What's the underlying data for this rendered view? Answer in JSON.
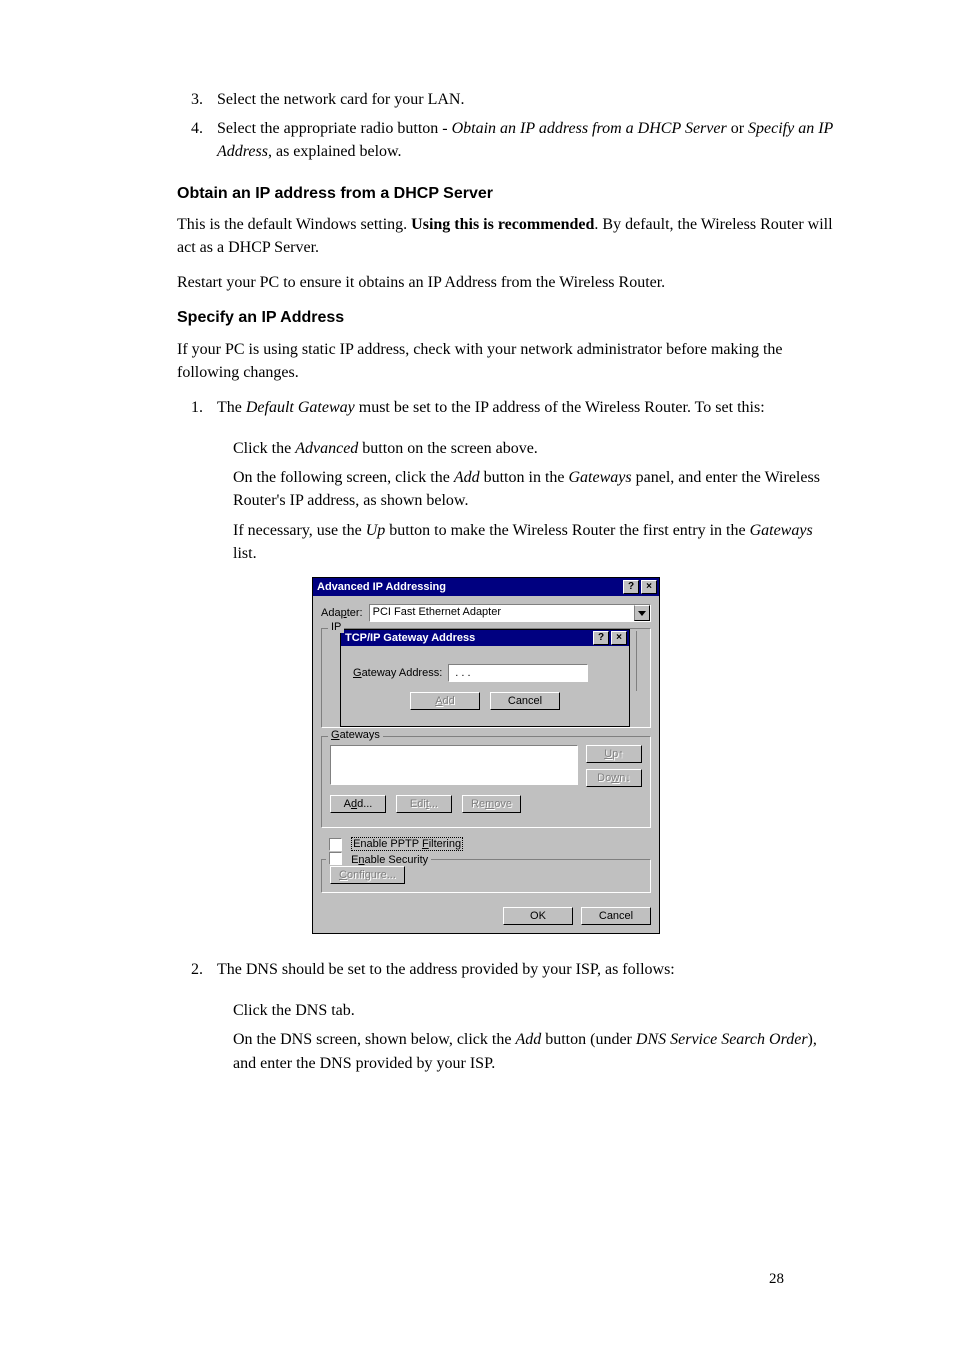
{
  "list_top": {
    "item3": "Select the network card for your LAN.",
    "item4_a": "Select the appropriate radio button - ",
    "item4_b": "Obtain an IP address from a DHCP Server",
    "item4_c": " or ",
    "item4_d": "Specify an IP Address",
    "item4_e": ", as explained below."
  },
  "sec1_heading": "Obtain an IP address from a DHCP Server",
  "sec1_p1_a": "This is the default Windows setting. ",
  "sec1_p1_b": "Using this is recommended",
  "sec1_p1_c": ". By default, the Wireless Router will act as a DHCP Server.",
  "sec1_p2": "Restart your PC to ensure it obtains an IP Address from the Wireless Router.",
  "sec2_heading": "Specify an IP Address",
  "sec2_p1": "If your PC is using static IP address, check with your network administrator before making the following changes.",
  "list_mid": {
    "item1_a": "The ",
    "item1_b": "Default Gateway",
    "item1_c": " must be set to the IP address of the Wireless Router. To set this:",
    "sub_a1": "Click the ",
    "sub_a2": "Advanced",
    "sub_a3": " button on the screen above.",
    "sub_b1": "On the following screen, click the ",
    "sub_b2": "Add",
    "sub_b3": " button in the ",
    "sub_b4": "Gateways",
    "sub_b5": " panel, and enter the Wireless Router's IP address, as shown below.",
    "sub_c1": "If necessary, use the ",
    "sub_c2": "Up",
    "sub_c3": " button to make the Wireless Router the first entry in the ",
    "sub_c4": "Gateways",
    "sub_c5": " list."
  },
  "dialog": {
    "main_title": "Advanced IP Addressing",
    "adapter_label_pre": "Ada",
    "adapter_label_ul": "p",
    "adapter_label_post": "ter:",
    "adapter_value": "PCI Fast Ethernet Adapter",
    "ip_group": "IP",
    "sub_title": "TCP/IP Gateway Address",
    "gw_addr_ul": "G",
    "gw_addr_post": "ateway Address:",
    "ip_dots": ".    .    .",
    "add_ul": "A",
    "add_post": "dd",
    "cancel": "Cancel",
    "gateways_ul": "G",
    "gateways_post": "ateways",
    "up_ul": "U",
    "up_post": "p↑",
    "down_pre": "Do",
    "down_ul": "w",
    "down_post": "n↓",
    "add2_pre": "A",
    "add2_ul": "d",
    "add2_post": "d...",
    "edit_pre": "Edi",
    "edit_ul": "t",
    "edit_post": "...",
    "remove_pre": "Re",
    "remove_ul": "m",
    "remove_post": "ove",
    "pptp_pre": "Enable PPTP ",
    "pptp_ul": "F",
    "pptp_post": "iltering",
    "sec_pre": "E",
    "sec_ul": "n",
    "sec_post": "able Security",
    "configure_ul": "C",
    "configure_post": "onfigure...",
    "ok": "OK",
    "cancel2": "Cancel",
    "help_q": "?",
    "close_x": "×"
  },
  "list_bot": {
    "item2": "The DNS should be set to the address provided by your ISP, as follows:",
    "sub_a": "Click the DNS tab.",
    "sub_b1": "On the DNS screen, shown below, click the ",
    "sub_b2": "Add",
    "sub_b3": " button (under ",
    "sub_b4": "DNS Service Search Order",
    "sub_b5": "), and enter the DNS provided by your ISP."
  },
  "page_number": "28"
}
